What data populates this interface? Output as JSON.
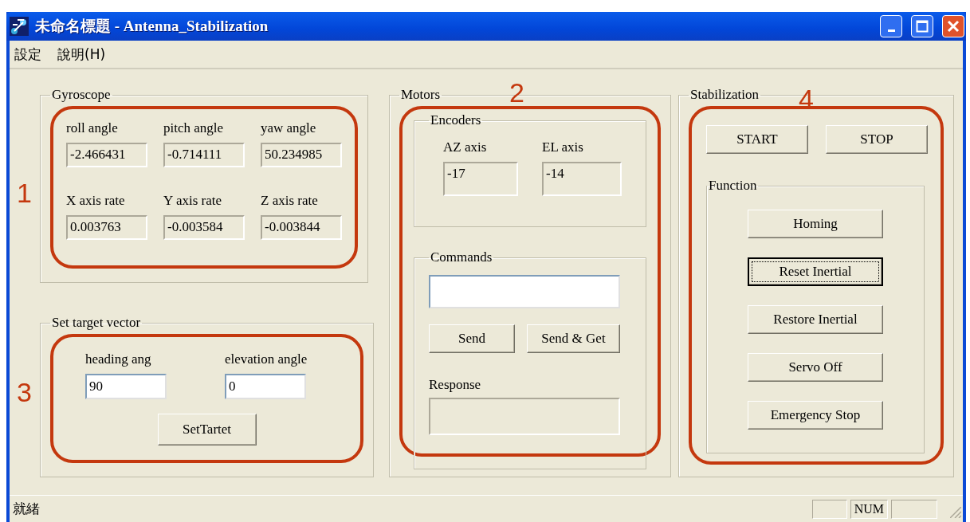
{
  "window": {
    "title": "未命名標題 - Antenna_Stabilization"
  },
  "menu": [
    {
      "label": "設定"
    },
    {
      "label": "說明(H)"
    }
  ],
  "gyroscope": {
    "title": "Gyroscope",
    "annotation": "1",
    "fields": [
      {
        "label": "roll angle",
        "value": "-2.466431"
      },
      {
        "label": "pitch angle",
        "value": "-0.714111"
      },
      {
        "label": "yaw angle",
        "value": "50.234985"
      },
      {
        "label": "X axis rate",
        "value": "0.003763"
      },
      {
        "label": "Y axis rate",
        "value": "-0.003584"
      },
      {
        "label": "Z axis rate",
        "value": "-0.003844"
      }
    ]
  },
  "target": {
    "title": "Set target vector",
    "annotation": "3",
    "fields": [
      {
        "label": "heading ang",
        "value": "90"
      },
      {
        "label": "elevation angle",
        "value": "0"
      }
    ],
    "button": "SetTartet"
  },
  "motors": {
    "title": "Motors",
    "annotation": "2",
    "encoders": {
      "title": "Encoders",
      "fields": [
        {
          "label": "AZ axis",
          "value": "-17"
        },
        {
          "label": "EL axis",
          "value": "-14"
        }
      ]
    },
    "commands": {
      "title": "Commands",
      "buttons": [
        "Send",
        "Send & Get"
      ],
      "response_label": "Response"
    }
  },
  "stabilization": {
    "title": "Stabilization",
    "annotation": "4",
    "buttons": [
      "START",
      "STOP"
    ],
    "function": {
      "title": "Function",
      "buttons": [
        {
          "label": "Homing",
          "focused": false
        },
        {
          "label": "Reset Inertial",
          "focused": true
        },
        {
          "label": "Restore Inertial",
          "focused": false
        },
        {
          "label": "Servo Off",
          "focused": false
        },
        {
          "label": "Emergency Stop",
          "focused": false
        }
      ]
    }
  },
  "status_bar": {
    "text": "就緒",
    "indicator": "NUM"
  }
}
